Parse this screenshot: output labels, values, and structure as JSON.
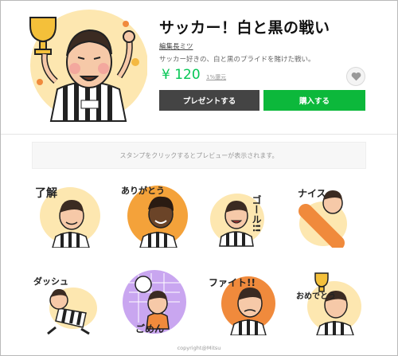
{
  "product": {
    "title": "サッカー！白と黒の戦い",
    "author": "編集長ミツ",
    "description": "サッカー好きの、白と黒のプライドを賭けた戦い。",
    "price": "¥ 120",
    "tax_link": "1%還元"
  },
  "buttons": {
    "present_label": "プレゼントする",
    "buy_label": "購入する"
  },
  "preview": {
    "hint": "スタンプをクリックするとプレビューが表示されます。"
  },
  "stickers": [
    {
      "text": "了解"
    },
    {
      "text": "ありがとう"
    },
    {
      "text": "ゴール!!"
    },
    {
      "text": "ナイス"
    },
    {
      "text": "ダッシュ"
    },
    {
      "text": "ごめん"
    },
    {
      "text": "ファイト!!"
    },
    {
      "text": "おめでとう"
    }
  ],
  "footer": {
    "copyright": "copyright@Mitsu"
  },
  "colors": {
    "accent_green": "#06c755",
    "buy_button": "#0cb83b",
    "present_button": "#444444"
  },
  "icons": {
    "favorite": "heart-icon"
  }
}
